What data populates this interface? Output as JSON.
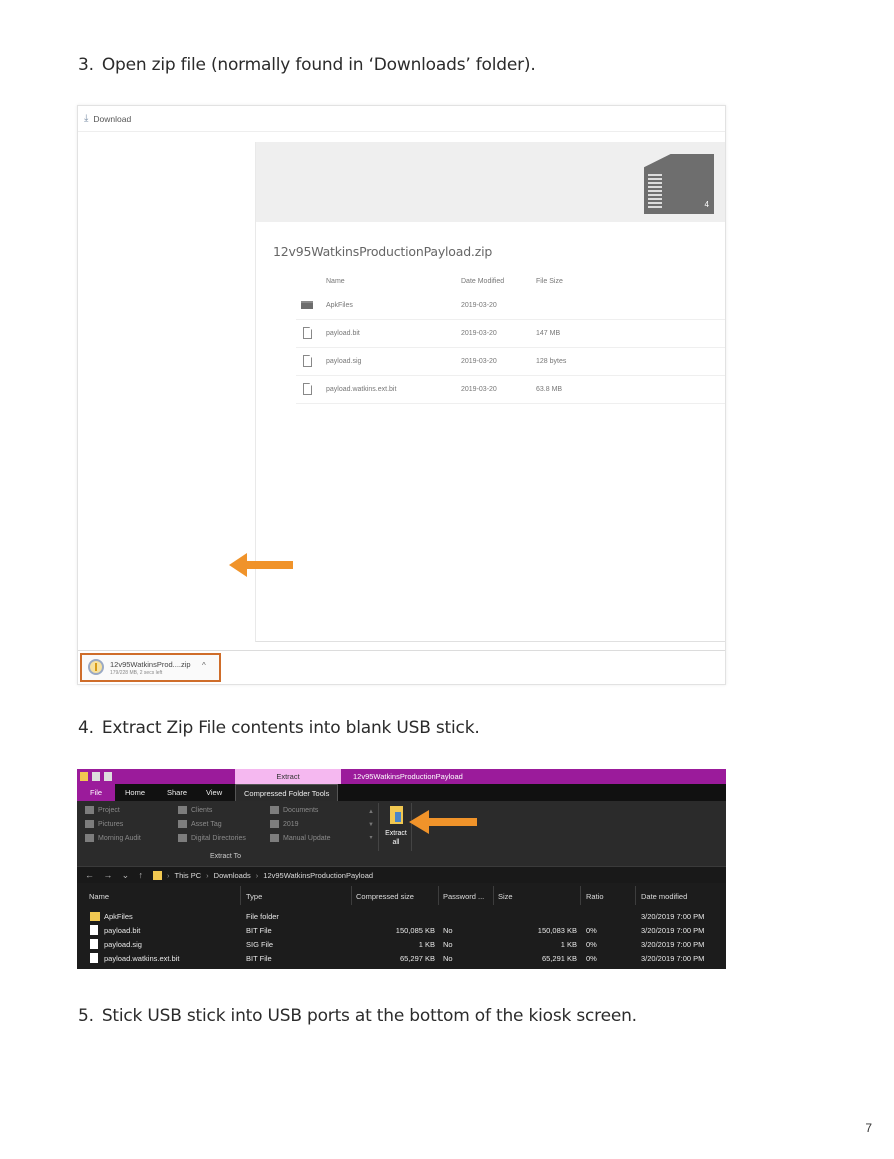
{
  "steps": [
    {
      "num": "3.",
      "text": "Open zip file (normally found in ‘Downloads’ folder)."
    },
    {
      "num": "4.",
      "text": "Extract Zip File contents into blank USB stick."
    },
    {
      "num": "5.",
      "text": "Stick USB stick into USB ports at the bottom of the kiosk screen."
    }
  ],
  "page_number": "7",
  "download_view": {
    "topbar_label": "Download",
    "zip_item_count": "4",
    "zip_title": "12v95WatkinsProductionPayload.zip",
    "columns": {
      "name": "Name",
      "date": "Date Modified",
      "size": "File Size"
    },
    "files": [
      {
        "type": "folder",
        "name": "ApkFiles",
        "date": "2019-03-20",
        "size": ""
      },
      {
        "type": "file",
        "name": "payload.bit",
        "date": "2019-03-20",
        "size": "147 MB"
      },
      {
        "type": "file",
        "name": "payload.sig",
        "date": "2019-03-20",
        "size": "128 bytes"
      },
      {
        "type": "file",
        "name": "payload.watkins.ext.bit",
        "date": "2019-03-20",
        "size": "63.8 MB"
      }
    ],
    "download_chip": {
      "filename": "12v95WatkinsProd....zip",
      "progress": "179/228 MB, 2 secs left",
      "caret": "^"
    },
    "accent_color": "#f0932a"
  },
  "explorer": {
    "extract_tab": "Extract",
    "window_title": "12v95WatkinsProductionPayload",
    "tabs": {
      "file": "File",
      "home": "Home",
      "share": "Share",
      "view": "View",
      "tools": "Compressed Folder Tools"
    },
    "destinations": [
      "Project",
      "Pictures",
      "Morning Audit",
      "Clients",
      "Asset Tag",
      "Digital Directories",
      "Documents",
      "2019",
      "Manual Update"
    ],
    "extract_all_label_1": "Extract",
    "extract_all_label_2": "all",
    "group_label": "Extract To",
    "breadcrumb": [
      "This PC",
      "Downloads",
      "12v95WatkinsProductionPayload"
    ],
    "columns": {
      "name": "Name",
      "type": "Type",
      "compressed": "Compressed size",
      "password": "Password ...",
      "size": "Size",
      "ratio": "Ratio",
      "modified": "Date modified"
    },
    "rows": [
      {
        "icon": "folder",
        "name": "ApkFiles",
        "type": "File folder",
        "compressed": "",
        "password": "",
        "size": "",
        "ratio": "",
        "modified": "3/20/2019 7:00 PM"
      },
      {
        "icon": "file",
        "name": "payload.bit",
        "type": "BIT File",
        "compressed": "150,085 KB",
        "password": "No",
        "size": "150,083 KB",
        "ratio": "0%",
        "modified": "3/20/2019 7:00 PM"
      },
      {
        "icon": "file",
        "name": "payload.sig",
        "type": "SIG File",
        "compressed": "1 KB",
        "password": "No",
        "size": "1 KB",
        "ratio": "0%",
        "modified": "3/20/2019 7:00 PM"
      },
      {
        "icon": "file",
        "name": "payload.watkins.ext.bit",
        "type": "BIT File",
        "compressed": "65,297 KB",
        "password": "No",
        "size": "65,291 KB",
        "ratio": "0%",
        "modified": "3/20/2019 7:00 PM"
      }
    ],
    "titlebar_color": "#9b1b9b"
  }
}
